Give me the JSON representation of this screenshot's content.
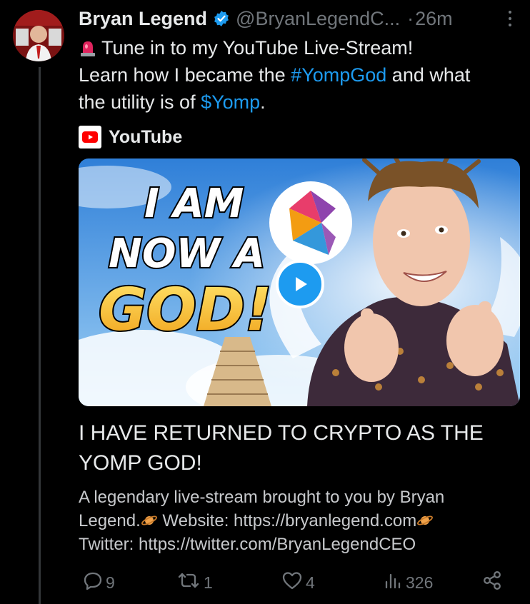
{
  "tweet": {
    "author_name": "Bryan Legend",
    "handle": "@BryanLegendC...",
    "separator": "·",
    "time": "26m",
    "text_line1": "Tune in to my YouTube Live-Stream!",
    "text_line2_pre": "Learn how I became the ",
    "hashtag": "#YompGod",
    "text_line2_post": " and what",
    "text_line3_pre": "the utility is of ",
    "cashtag": "$Yomp",
    "text_line3_post": "."
  },
  "card": {
    "source": "YouTube",
    "thumbnail_text": [
      "I AM",
      "NOW A",
      "GOD!"
    ],
    "title": "I HAVE RETURNED TO CRYPTO AS THE YOMP GOD!",
    "desc_line1": "A legendary live-stream brought to you by Bryan",
    "desc_line2_a": "Legend.",
    "desc_line2_b": " Website: https://bryanlegend.com",
    "desc_line3": "Twitter: https://twitter.com/BryanLegendCEO"
  },
  "actions": {
    "replies": "9",
    "reposts": "1",
    "likes": "4",
    "views": "326"
  },
  "colors": {
    "background": "#000000",
    "text": "#e7e9ea",
    "muted": "#71767b",
    "link": "#1d9bf0"
  },
  "icons": [
    "verified-badge-icon",
    "more-icon",
    "siren-icon",
    "youtube-icon",
    "play-icon",
    "planet-icon",
    "reply-icon",
    "repost-icon",
    "like-icon",
    "views-icon",
    "share-icon"
  ]
}
